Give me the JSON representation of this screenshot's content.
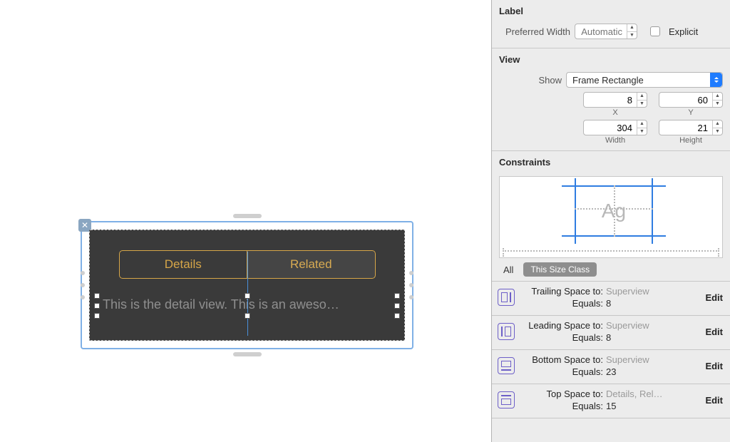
{
  "canvas": {
    "tabs": [
      "Details",
      "Related"
    ],
    "label_text": "This is the detail view. This is an aweso…"
  },
  "inspector": {
    "label_section": {
      "title": "Label",
      "pref_width_caption": "Preferred Width",
      "pref_width_placeholder": "Automatic",
      "explicit_label": "Explicit"
    },
    "view_section": {
      "title": "View",
      "show_caption": "Show",
      "show_value": "Frame Rectangle",
      "x": "8",
      "y": "60",
      "width": "304",
      "height": "21",
      "x_caption": "X",
      "y_caption": "Y",
      "w_caption": "Width",
      "h_caption": "Height"
    },
    "constraints": {
      "title": "Constraints",
      "preview_glyph": "Ag",
      "tab_all": "All",
      "tab_size": "This Size Class",
      "edit_label": "Edit",
      "items": [
        {
          "icon": "trailing",
          "prop": "Trailing Space to:",
          "target": "Superview",
          "equals_label": "Equals:",
          "equals": "8"
        },
        {
          "icon": "leading",
          "prop": "Leading Space to:",
          "target": "Superview",
          "equals_label": "Equals:",
          "equals": "8"
        },
        {
          "icon": "bottom",
          "prop": "Bottom Space to:",
          "target": "Superview",
          "equals_label": "Equals:",
          "equals": "23"
        },
        {
          "icon": "top",
          "prop": "Top Space to:",
          "target": "Details, Rel…",
          "equals_label": "Equals:",
          "equals": "15"
        }
      ]
    }
  }
}
